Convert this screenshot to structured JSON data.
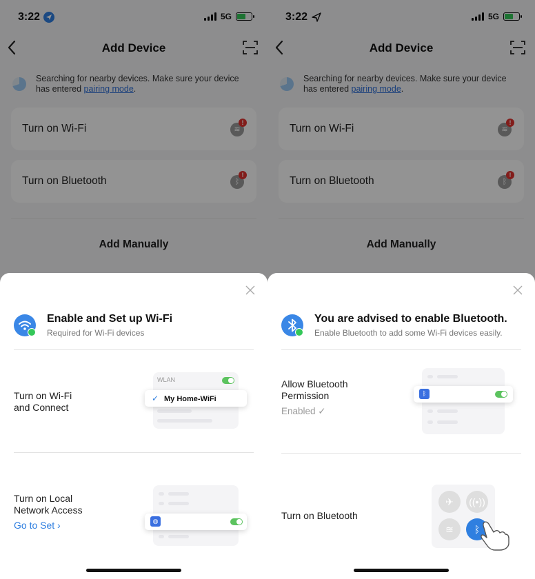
{
  "status_bar": {
    "time": "3:22",
    "network": "5G"
  },
  "nav": {
    "title": "Add Device"
  },
  "search_tip": {
    "text": "Searching for nearby devices. Make sure your device has entered ",
    "link": "pairing mode",
    "suffix": "."
  },
  "cards": {
    "wifi": "Turn on Wi-Fi",
    "bluetooth": "Turn on Bluetooth",
    "alert_glyph": "!"
  },
  "add_manually": "Add Manually",
  "left_sheet": {
    "title": "Enable and Set up Wi-Fi",
    "subtitle": "Required for Wi-Fi devices",
    "step1": {
      "label": "Turn on Wi-Fi\nand Connect",
      "illus": {
        "wlan": "WLAN",
        "network": "My Home-WiFi",
        "check": "✓"
      }
    },
    "step2": {
      "label": "Turn on Local\nNetwork Access",
      "link": "Go to Set ›"
    }
  },
  "right_sheet": {
    "title": "You are advised to enable Bluetooth.",
    "subtitle": "Enable Bluetooth to add some Wi-Fi devices easily.",
    "step1": {
      "label": "Allow Bluetooth\nPermission",
      "status": "Enabled ✓"
    },
    "step2": {
      "label": "Turn on Bluetooth"
    }
  },
  "colors": {
    "accent": "#2f7fe0",
    "toggle_on": "#5cc35f",
    "alert": "#e0332f"
  },
  "icons": [
    "location-icon",
    "signal-icon",
    "battery-icon",
    "back-icon",
    "scan-icon",
    "spinner-icon",
    "wifi-icon",
    "bluetooth-icon",
    "close-icon",
    "check-icon",
    "airplane-icon",
    "cellular-icon",
    "hand-pointer-icon"
  ]
}
